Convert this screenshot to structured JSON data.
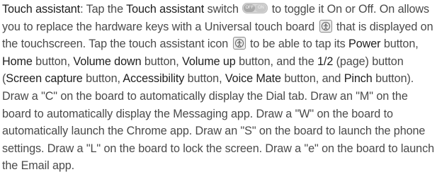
{
  "text": {
    "s1": "Touch assistant",
    "s2": ": Tap the ",
    "s3": "Touch assistant",
    "s4": " switch ",
    "s5": " to toggle it On or Off. On allows you to replace the hardware keys with a Universal touch board ",
    "s6": " that is displayed on the touchscreen. Tap the touch assistant icon ",
    "s7": " to be able to tap its ",
    "s8": "Power",
    "s9": " button, ",
    "s10": "Home",
    "s11": " button, ",
    "s12": "Volume down",
    "s13": " button, ",
    "s14": "Volume up",
    "s15": " button, and the ",
    "s16": "1/2",
    "s17": " (page) button (",
    "s18": "Screen capture",
    "s19": " button, ",
    "s20": "Accessibility",
    "s21": " button, ",
    "s22": "Voice Mate",
    "s23": " button, and ",
    "s24": "Pinch",
    "s25": " button). Draw a \"C\" on the board to automatically display the Dial tab. Draw an \"M\" on the board to automatically display the Messaging app. Draw a \"W\" on the board to automatically launch the Chrome app. Draw an \"S\" on the board to launch the phone settings. Draw a \"L\" on the board to lock the screen. Draw a \"e\" on the board to launch the Email app."
  },
  "icons": {
    "switch": {
      "name": "toggle-switch-icon",
      "off_label": "OFF",
      "on_label": "ON"
    },
    "touch_board": {
      "name": "touch-assistant-icon"
    }
  },
  "colors": {
    "body_text": "#4a4a4a",
    "bold_text": "#1e1e1e"
  }
}
